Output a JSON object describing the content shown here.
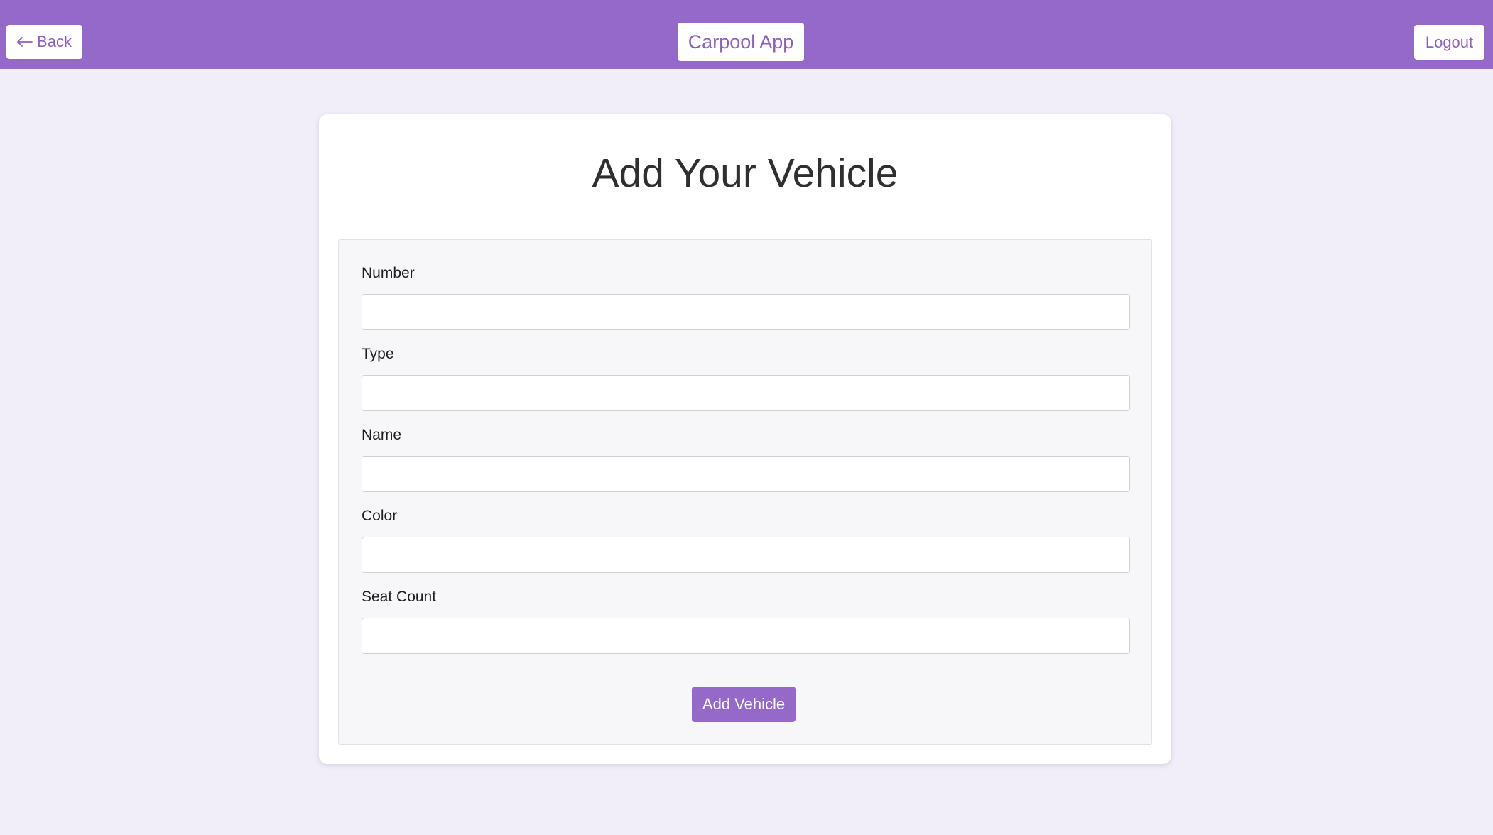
{
  "header": {
    "back_label": "Back",
    "brand": "Carpool App",
    "logout_label": "Logout"
  },
  "page": {
    "title": "Add Your Vehicle"
  },
  "form": {
    "fields": [
      {
        "label": "Number",
        "value": ""
      },
      {
        "label": "Type",
        "value": ""
      },
      {
        "label": "Name",
        "value": ""
      },
      {
        "label": "Color",
        "value": ""
      },
      {
        "label": "Seat Count",
        "value": ""
      }
    ],
    "submit_label": "Add Vehicle"
  },
  "colors": {
    "accent": "#9569c9",
    "background": "#f1eef9",
    "panel": "#f7f7fa"
  },
  "icons": {
    "back": "arrow-left-icon"
  }
}
